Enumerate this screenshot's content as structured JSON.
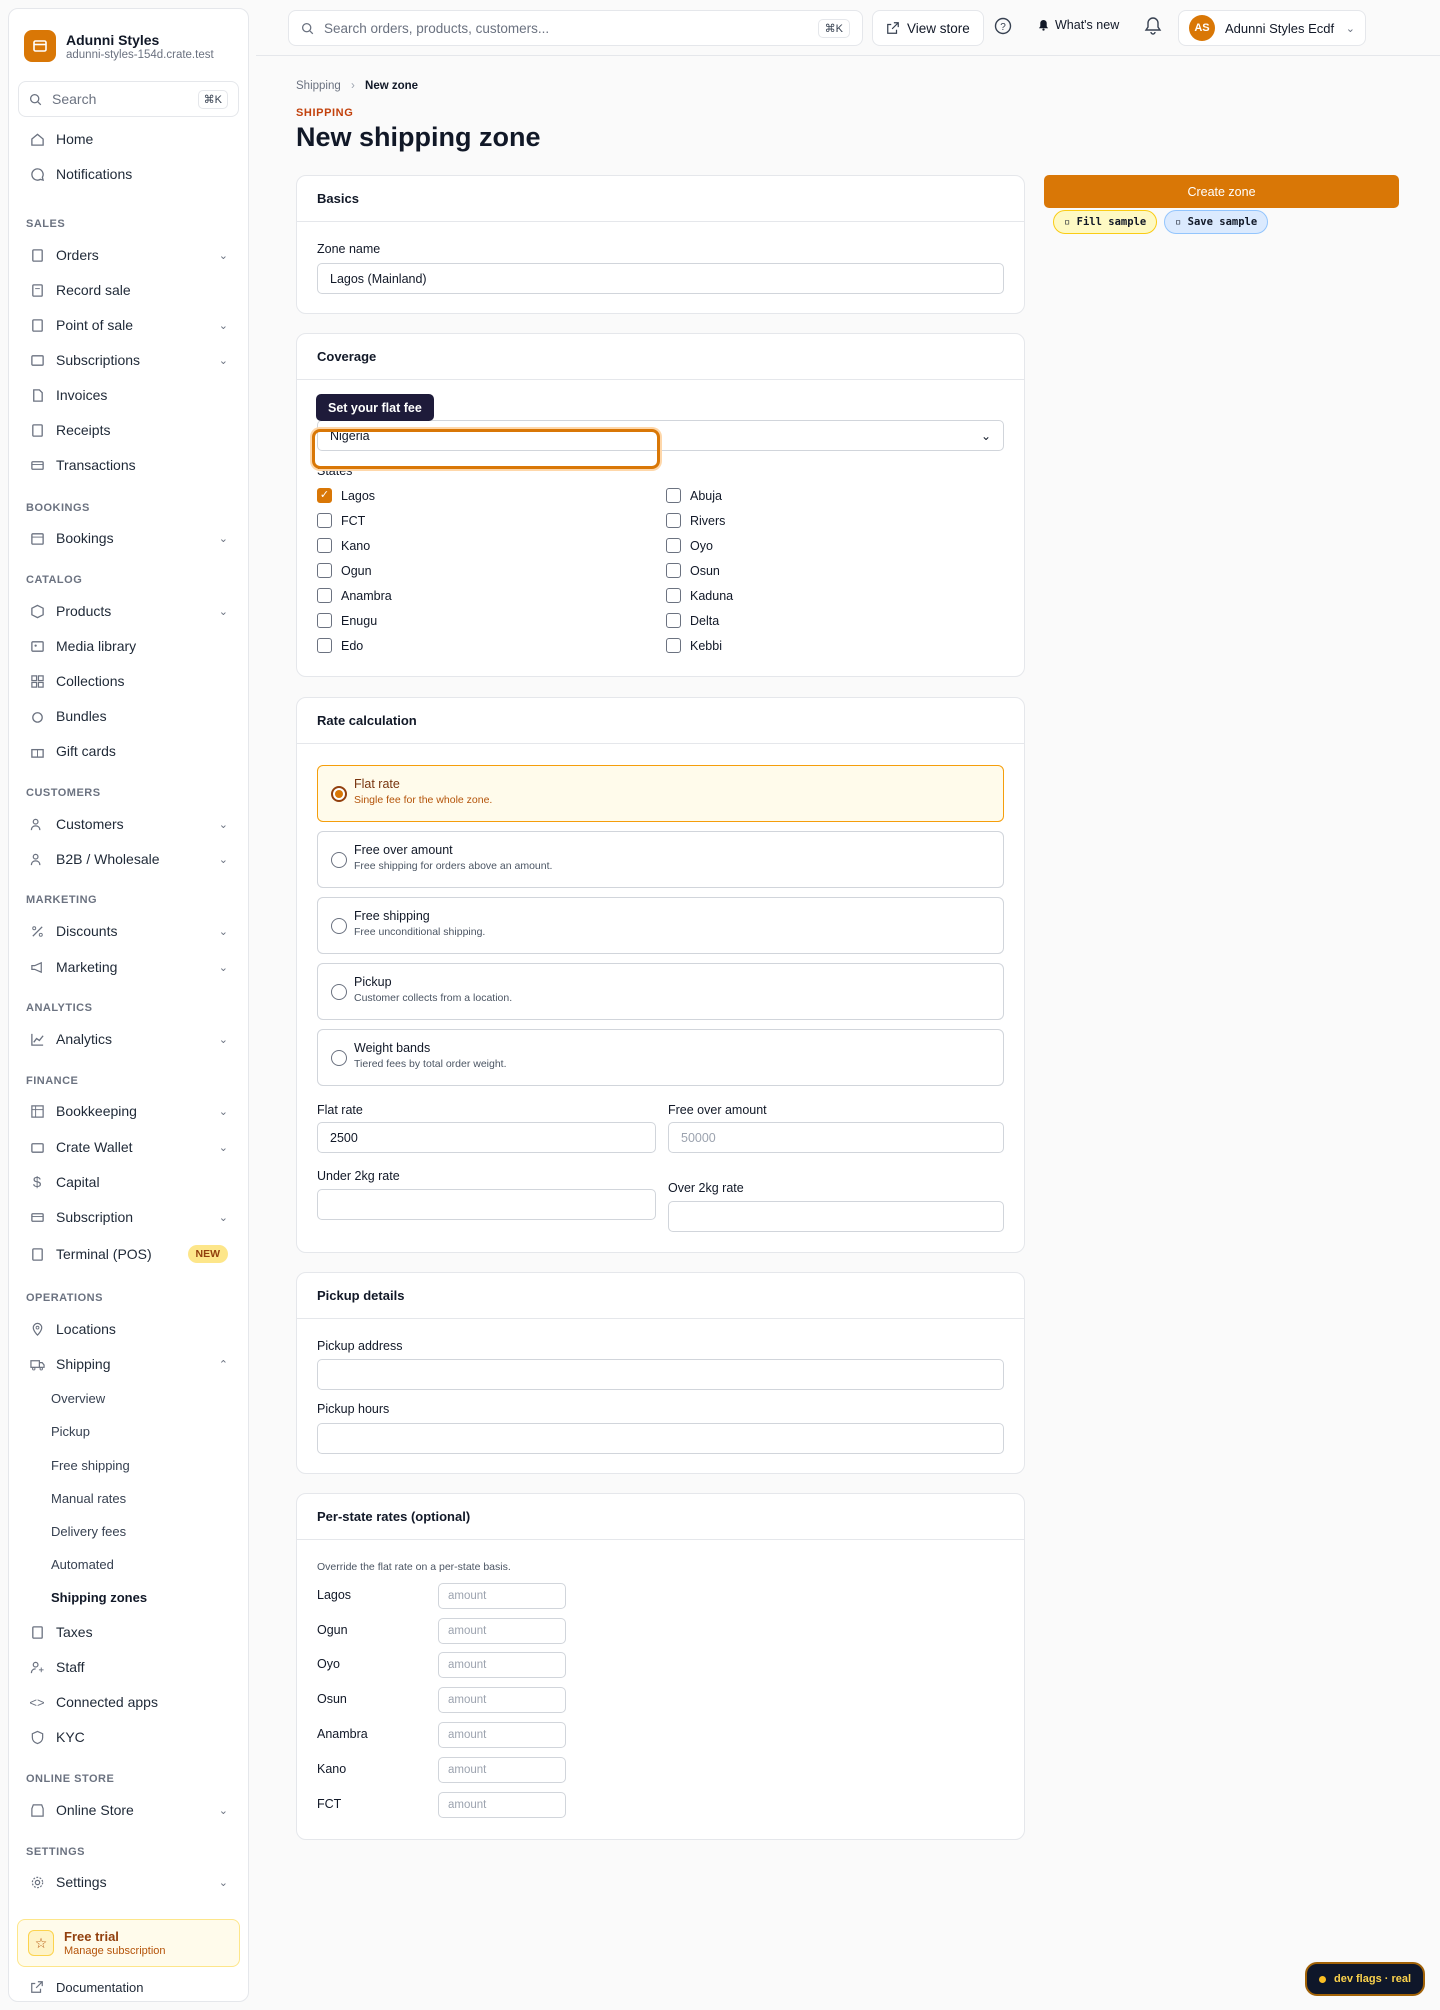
{
  "brand": {
    "name": "Adunni Styles",
    "domain": "adunni-styles-154d.crate.test"
  },
  "sidebar": {
    "search_placeholder": "Search",
    "search_shortcut": "⌘K",
    "home": "Home",
    "notifications": "Notifications",
    "sections": {
      "sales": "SALES",
      "bookings": "BOOKINGS",
      "catalog": "CATALOG",
      "customers": "CUSTOMERS",
      "marketing": "MARKETING",
      "analytics": "ANALYTICS",
      "finance": "FINANCE",
      "operations": "OPERATIONS",
      "online_store": "ONLINE STORE",
      "settings": "SETTINGS"
    },
    "items": {
      "orders": "Orders",
      "record_sale": "Record sale",
      "point_of_sale": "Point of sale",
      "subscriptions": "Subscriptions",
      "invoices": "Invoices",
      "receipts": "Receipts",
      "transactions": "Transactions",
      "bookings": "Bookings",
      "products": "Products",
      "media_library": "Media library",
      "collections": "Collections",
      "bundles": "Bundles",
      "gift_cards": "Gift cards",
      "customers": "Customers",
      "b2b": "B2B / Wholesale",
      "discounts": "Discounts",
      "marketing": "Marketing",
      "analytics": "Analytics",
      "bookkeeping": "Bookkeeping",
      "crate_wallet": "Crate Wallet",
      "capital": "Capital",
      "subscription": "Subscription",
      "terminal": "Terminal (POS)",
      "terminal_badge": "NEW",
      "locations": "Locations",
      "shipping": "Shipping",
      "taxes": "Taxes",
      "staff": "Staff",
      "connected_apps": "Connected apps",
      "kyc": "KYC",
      "online_store": "Online Store",
      "settings": "Settings"
    },
    "shipping_sub": {
      "overview": "Overview",
      "pickup": "Pickup",
      "free_shipping": "Free shipping",
      "manual_rates": "Manual rates",
      "delivery_fees": "Delivery fees",
      "automated": "Automated",
      "shipping_zones": "Shipping zones"
    },
    "trial": {
      "title": "Free trial",
      "subtitle": "Manage subscription"
    },
    "documentation": "Documentation"
  },
  "topbar": {
    "search_placeholder": "Search orders, products, customers...",
    "search_shortcut": "⌘K",
    "view_store": "View store",
    "whats_new": "What's new",
    "account_initials": "AS",
    "account_name": "Adunni Styles Ecdf"
  },
  "page": {
    "breadcrumb_parent": "Shipping",
    "breadcrumb_sep": "›",
    "breadcrumb_current": "New zone",
    "eyebrow": "SHIPPING",
    "title": "New shipping zone"
  },
  "basics": {
    "heading": "Basics",
    "zone_name_label": "Zone name",
    "zone_name_value": "Lagos (Mainland)"
  },
  "coverage": {
    "heading": "Coverage",
    "tooltip": "Set your flat fee",
    "country_value": "Nigeria",
    "states_label": "States",
    "states_left": [
      {
        "name": "Lagos",
        "checked": true
      },
      {
        "name": "FCT",
        "checked": false
      },
      {
        "name": "Kano",
        "checked": false
      },
      {
        "name": "Ogun",
        "checked": false
      },
      {
        "name": "Anambra",
        "checked": false
      },
      {
        "name": "Enugu",
        "checked": false
      },
      {
        "name": "Edo",
        "checked": false
      }
    ],
    "states_right": [
      {
        "name": "Abuja",
        "checked": false
      },
      {
        "name": "Rivers",
        "checked": false
      },
      {
        "name": "Oyo",
        "checked": false
      },
      {
        "name": "Osun",
        "checked": false
      },
      {
        "name": "Kaduna",
        "checked": false
      },
      {
        "name": "Delta",
        "checked": false
      },
      {
        "name": "Kebbi",
        "checked": false
      }
    ]
  },
  "rate": {
    "heading": "Rate calculation",
    "options": [
      {
        "title": "Flat rate",
        "desc": "Single fee for the whole zone.",
        "selected": true
      },
      {
        "title": "Free over amount",
        "desc": "Free shipping for orders above an amount.",
        "selected": false
      },
      {
        "title": "Free shipping",
        "desc": "Free unconditional shipping.",
        "selected": false
      },
      {
        "title": "Pickup",
        "desc": "Customer collects from a location.",
        "selected": false
      },
      {
        "title": "Weight bands",
        "desc": "Tiered fees by total order weight.",
        "selected": false
      }
    ],
    "flat_rate_label": "Flat rate",
    "flat_rate_value": "2500",
    "free_over_label": "Free over amount",
    "free_over_placeholder": "50000",
    "under2kg_label": "Under 2kg rate",
    "over2kg_label": "Over 2kg rate"
  },
  "pickup": {
    "heading": "Pickup details",
    "address_label": "Pickup address",
    "hours_label": "Pickup hours"
  },
  "per_state": {
    "heading": "Per-state rates (optional)",
    "hint": "Override the flat rate on a per-state basis.",
    "placeholder": "amount",
    "states": [
      "Lagos",
      "Ogun",
      "Oyo",
      "Osun",
      "Anambra",
      "Kano",
      "FCT"
    ]
  },
  "actions": {
    "create": "Create zone",
    "fill_sample": "▫ Fill sample",
    "save_sample": "▫ Save sample"
  },
  "devflags": "dev flags · real",
  "colors": {
    "accent": "#d97706",
    "accent_light": "#fffbeb"
  }
}
